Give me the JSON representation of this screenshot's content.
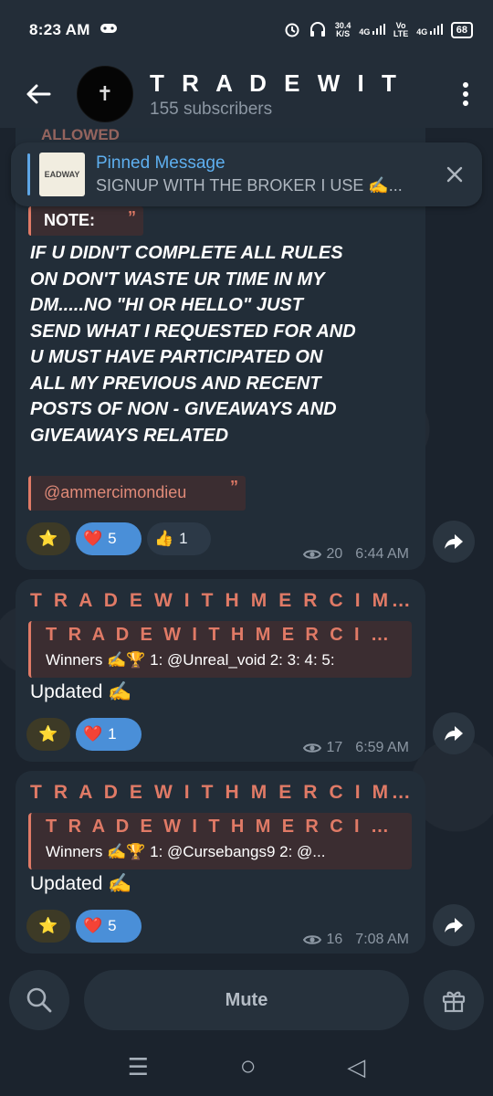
{
  "status_bar": {
    "time": "8:23 AM",
    "net_speed_value": "30.4",
    "net_speed_unit": "K/S",
    "signal1": "4G",
    "volte_top": "Vo",
    "volte_bottom": "LTE",
    "signal2": "4G",
    "battery": "68"
  },
  "header": {
    "title": "T R A D E  W I T H  M",
    "subtitle": "155 subscribers",
    "avatar_glyph": "✝"
  },
  "pinned": {
    "label": "Pinned Message",
    "preview": "SIGNUP WITH THE BROKER I USE ✍️...",
    "thumb_text": "EADWAY"
  },
  "messages": [
    {
      "top_cut_text": "ALLOWED",
      "quote_label": "NOTE:",
      "quote_mark": "”",
      "body_lines": [
        "IF U DIDN'T COMPLETE ALL RULES",
        "ON DON'T WASTE UR TIME IN MY",
        "DM.....NO \"HI OR HELLO\" JUST",
        "SEND WHAT I REQUESTED FOR AND",
        "U MUST HAVE PARTICIPATED ON",
        "ALL MY PREVIOUS AND RECENT",
        "POSTS OF NON - GIVEAWAYS AND",
        "GIVEAWAYS RELATED"
      ],
      "mention": "@ammercimondieu",
      "mention_mark": "”",
      "reactions": {
        "star": "⭐",
        "heart": "❤️",
        "heart_count": "5",
        "thumb": "👍",
        "thumb_count": "1"
      },
      "views": "20",
      "time": "6:44 AM"
    },
    {
      "sender": "T R A D E  W I T H  M E R C I  M O N  D...",
      "reply_title": "T R A D E  W I T H  M E R C I  M O N...",
      "reply_text": "Winners ✍️🏆   1: @Unreal_void 2: 3: 4: 5:",
      "text": "Updated ✍️",
      "reactions": {
        "star": "⭐",
        "heart": "❤️",
        "heart_count": "1"
      },
      "views": "17",
      "time": "6:59 AM"
    },
    {
      "sender": "T R A D E  W I T H  M E R C I  M O N  D...",
      "reply_title": "T R A D E  W I T H  M E R C I  M O N...",
      "reply_text": "Winners ✍️🏆   1: @Cursebangs9 2: @...",
      "text": "Updated ✍️",
      "reactions": {
        "star": "⭐",
        "heart": "❤️",
        "heart_count": "5"
      },
      "views": "16",
      "time": "7:08 AM"
    }
  ],
  "bottom": {
    "mute_label": "Mute"
  },
  "nav": {
    "recents": "☰",
    "home": "○",
    "back": "◁"
  },
  "colors": {
    "accent_quote": "#e07a66",
    "pinned_blue": "#5eafef",
    "bubble": "#222d38",
    "heart_pill": "#4a8fd8"
  }
}
